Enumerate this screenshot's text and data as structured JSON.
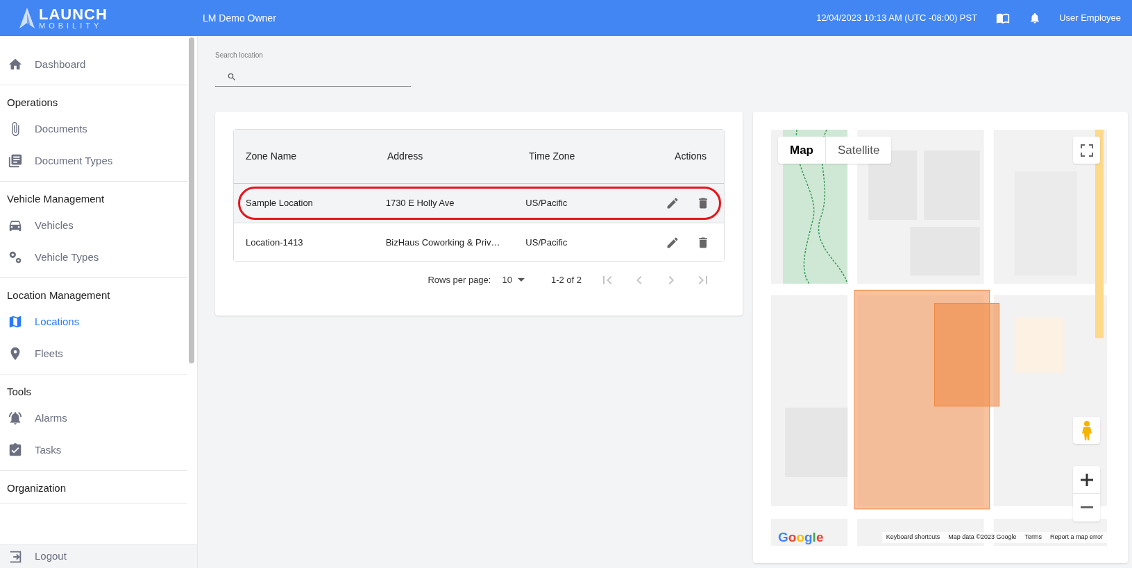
{
  "header": {
    "logo": {
      "name": "LAUNCH",
      "tagline": "MOBILITY"
    },
    "account": "LM Demo Owner",
    "datetime": "12/04/2023 10:13 AM (UTC -08:00) PST",
    "user": "User Employee"
  },
  "sidebar": {
    "top": [
      {
        "label": "Dashboard",
        "kind": "home",
        "selected": false
      }
    ],
    "sections": [
      {
        "title": "Operations",
        "items": [
          {
            "label": "Documents",
            "kind": "clip",
            "selected": false
          },
          {
            "label": "Document Types",
            "kind": "stack",
            "selected": false
          }
        ]
      },
      {
        "title": "Vehicle Management",
        "items": [
          {
            "label": "Vehicles",
            "kind": "car",
            "selected": false
          },
          {
            "label": "Vehicle Types",
            "kind": "gears",
            "selected": false
          }
        ]
      },
      {
        "title": "Location Management",
        "items": [
          {
            "label": "Locations",
            "kind": "map",
            "selected": true
          },
          {
            "label": "Fleets",
            "kind": "pin",
            "selected": false
          }
        ]
      },
      {
        "title": "Tools",
        "items": [
          {
            "label": "Alarms",
            "kind": "alarm",
            "selected": false
          },
          {
            "label": "Tasks",
            "kind": "task",
            "selected": false
          }
        ]
      },
      {
        "title": "Organization"
      }
    ],
    "logout": "Logout"
  },
  "search": {
    "label": "Search location"
  },
  "table": {
    "columns": [
      "Zone Name",
      "Address",
      "Time Zone",
      "Actions"
    ],
    "rows": [
      {
        "zone": "Sample Location",
        "address": "1730 E Holly Ave",
        "time_zone": "US/Pacific",
        "highlighted": true
      },
      {
        "zone": "Location-1413",
        "address": "BizHaus Coworking & Priv…",
        "time_zone": "US/Pacific",
        "highlighted": false
      }
    ],
    "pagination": {
      "rows_per_page_label": "Rows per page:",
      "rows_per_page": "10",
      "range": "1-2 of 2",
      "buttons": [
        {
          "kind": "first",
          "disabled": true
        },
        {
          "kind": "prev",
          "disabled": true
        },
        {
          "kind": "next",
          "disabled": true
        },
        {
          "kind": "last",
          "disabled": true
        }
      ]
    }
  },
  "map": {
    "types": [
      {
        "label": "Map",
        "selected": true
      },
      {
        "label": "Satellite",
        "selected": false
      }
    ],
    "logo": "Google",
    "footer": [
      "Keyboard shortcuts",
      "Map data ©2023 Google",
      "Terms",
      "Report a map error"
    ]
  }
}
